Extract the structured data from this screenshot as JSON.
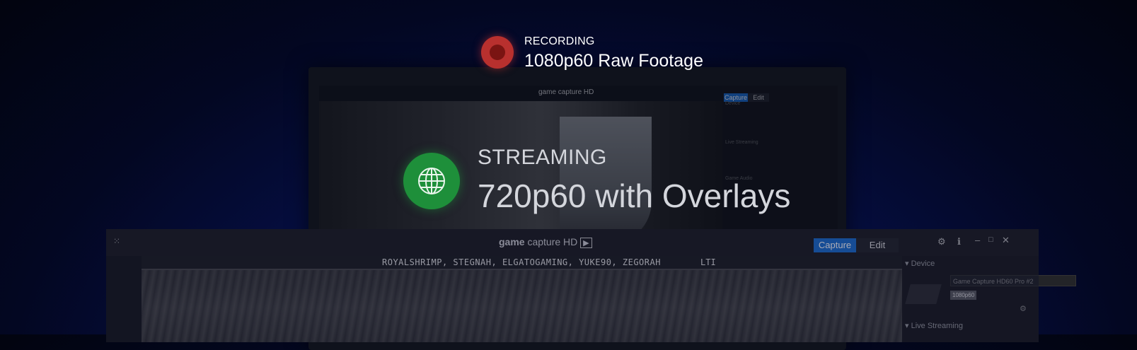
{
  "recording": {
    "label": "RECORDING",
    "description": "1080p60 Raw Footage",
    "color": "#b8302e"
  },
  "streaming": {
    "label": "STREAMING",
    "description": "720p60 with Overlays",
    "color": "#1e8f3a",
    "icon": "globe-icon"
  },
  "back_app": {
    "title_light": "game capture HD",
    "tabs": [
      "Capture",
      "Edit"
    ],
    "sections": [
      "Device",
      "Live Streaming",
      "Game Audio"
    ]
  },
  "front_app": {
    "title_bold": "game",
    "title_light": "capture HD",
    "tabs": {
      "capture": "Capture",
      "edit": "Edit"
    },
    "sections": {
      "device": "Device",
      "live_streaming": "Live Streaming"
    },
    "device_name": "Game Capture HD60 Pro #2",
    "resolution_chip": "1080p60",
    "banner": "ROYALSHRIMP, STEGNAH, ELGATOGAMING, YUKE90, ZEGORAH",
    "banner_end": "LTI"
  },
  "colors": {
    "accent": "#1e6fd0"
  }
}
